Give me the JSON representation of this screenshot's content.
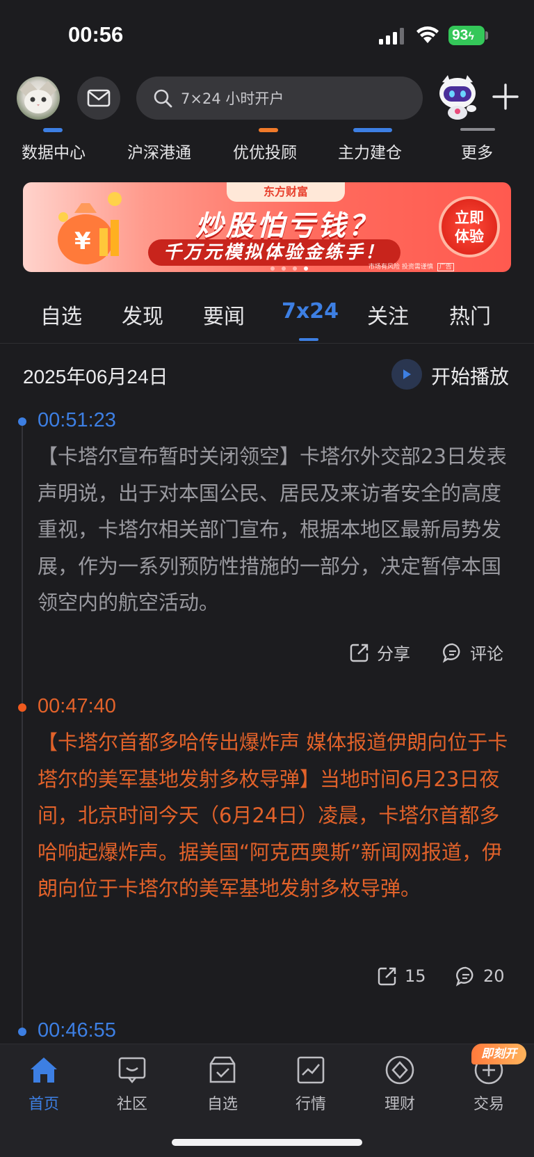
{
  "status_bar": {
    "time": "00:56",
    "battery": "93"
  },
  "header": {
    "search_placeholder": "7×24 小时开户"
  },
  "quick_entries": [
    {
      "label": "数据中心",
      "accent": "#3d7fe3"
    },
    {
      "label": "沪深港通",
      "accent": ""
    },
    {
      "label": "优优投顾",
      "accent": "#f07a2a"
    },
    {
      "label": "主力建仓",
      "accent": "#3d7fe3"
    },
    {
      "label": "更多",
      "accent": "#8a8a8f"
    }
  ],
  "banner": {
    "brand": "东方财富",
    "title": "炒股怕亏钱？",
    "subtitle": "千万元模拟体验金练手！",
    "cta_line1": "立即",
    "cta_line2": "体验",
    "note": "市场有风险 投资需谨慎",
    "ad_tag": "广告",
    "page_count": 4,
    "active_page": 4
  },
  "tabs": [
    "自选",
    "发现",
    "要闻",
    "7x24",
    "关注",
    "热门"
  ],
  "active_tab": "7x24",
  "feed": {
    "date": "2025年06月24日",
    "play_label": "开始播放",
    "items": [
      {
        "time": "00:51:23",
        "text": "【卡塔尔宣布暂时关闭领空】卡塔尔外交部23日发表声明说，出于对本国公民、居民及来访者安全的高度重视，卡塔尔相关部门宣布，根据本地区最新局势发展，作为一系列预防性措施的一部分，决定暂停本国领空内的航空活动。",
        "share_label": "分享",
        "comment_label": "评论",
        "highlight": false
      },
      {
        "time": "00:47:40",
        "text": "【卡塔尔首都多哈传出爆炸声 媒体报道伊朗向位于卡塔尔的美军基地发射多枚导弹】当地时间6月23日夜间，北京时间今天（6月24日）凌晨，卡塔尔首都多哈响起爆炸声。据美国“阿克西奥斯”新闻网报道，伊朗向位于卡塔尔的美军基地发射多枚导弹。",
        "share_label": "15",
        "comment_label": "20",
        "highlight": true
      },
      {
        "time": "00:46:55",
        "highlight": false
      }
    ]
  },
  "bottom_nav": {
    "items": [
      "首页",
      "社区",
      "自选",
      "行情",
      "理财",
      "交易"
    ],
    "active": "首页",
    "badge": "即刻开"
  },
  "colors": {
    "accent_blue": "#3d7fe3",
    "highlight_orange": "#e2622a",
    "muted_text": "#9a9aa0",
    "background": "#1c1c1f"
  }
}
